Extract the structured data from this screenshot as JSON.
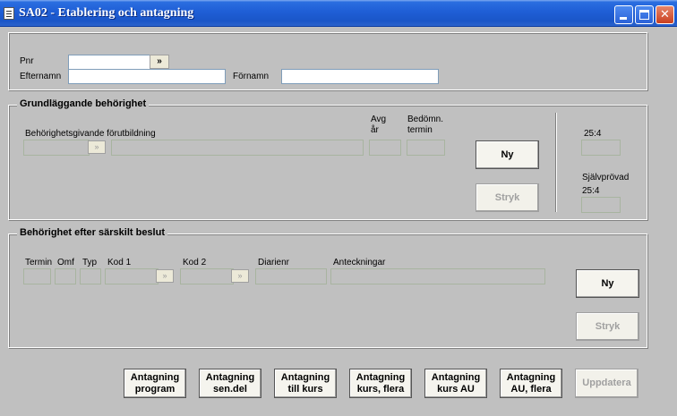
{
  "window": {
    "title": "SA02 - Etablering och antagning"
  },
  "person": {
    "pnr_label": "Pnr",
    "pnr_value": "",
    "pnr_lookup": "»",
    "efternamn_label": "Efternamn",
    "efternamn_value": "",
    "fornamn_label": "Förnamn",
    "fornamn_value": ""
  },
  "grund": {
    "title": "Grundläggande behörighet",
    "utbildning_label": "Behörighetsgivande förutbildning",
    "avg_label_1": "Avg",
    "avg_label_2": "år",
    "bedomn_label_1": "Bedömn.",
    "bedomn_label_2": "termin",
    "picker": "»",
    "ny_label": "Ny",
    "stryk_label": "Stryk",
    "label_254": "25:4",
    "sjalvprovad_label": "Självprövad",
    "sjalvprovad_254": "25:4"
  },
  "sarskilt": {
    "title": "Behörighet efter särskilt beslut",
    "columns": {
      "termin": "Termin",
      "omf": "Omf",
      "typ": "Typ",
      "kod1": "Kod 1",
      "kod2": "Kod 2",
      "diarienr": "Diarienr",
      "anteckningar": "Anteckningar"
    },
    "picker": "»",
    "ny_label": "Ny",
    "stryk_label": "Stryk"
  },
  "actions": [
    {
      "line1": "Antagning",
      "line2": "program"
    },
    {
      "line1": "Antagning",
      "line2": "sen.del"
    },
    {
      "line1": "Antagning",
      "line2": "till kurs"
    },
    {
      "line1": "Antagning",
      "line2": "kurs, flera"
    },
    {
      "line1": "Antagning",
      "line2": "kurs AU"
    },
    {
      "line1": "Antagning",
      "line2": "AU, flera"
    }
  ],
  "uppdatera_label": "Uppdatera"
}
